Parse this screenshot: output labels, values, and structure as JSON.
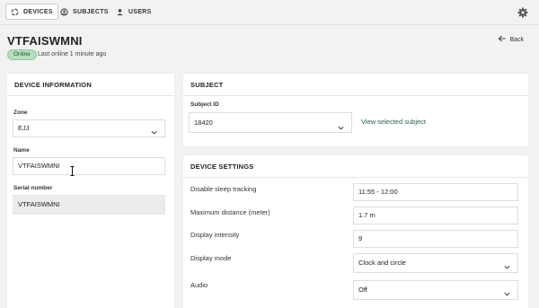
{
  "nav": {
    "tabs": [
      {
        "label": "DEVICES",
        "icon": "devices-icon"
      },
      {
        "label": "SUBJECTS",
        "icon": "subjects-icon"
      },
      {
        "label": "USERS",
        "icon": "user-icon"
      }
    ],
    "settings_icon": "gear-icon"
  },
  "header": {
    "title": "VTFAISWMNI",
    "back_label": "Back",
    "status_badge": "Online",
    "last_online": "Last online 1 minute ago"
  },
  "device_info": {
    "heading": "DEVICE INFORMATION",
    "zone_label": "Zone",
    "zone_value": "EJJ",
    "name_label": "Name",
    "name_value": "VTFAISWMNI",
    "serial_label": "Serial number",
    "serial_value": "VTFAISWMNI"
  },
  "subject": {
    "heading": "SUBJECT",
    "id_label": "Subject ID",
    "id_value": "18420",
    "view_link": "View selected subject"
  },
  "settings": {
    "heading": "DEVICE SETTINGS",
    "rows": [
      {
        "label": "Disable sleep tracking",
        "value": "11:55 - 12:00"
      },
      {
        "label": "Maximum distance (meter)",
        "value": "1.7 m"
      },
      {
        "label": "Display intensity",
        "value": "9"
      },
      {
        "label": "Display mode",
        "value": "Clock and circle"
      },
      {
        "label": "Audio",
        "value": "Off"
      }
    ]
  },
  "colors": {
    "background": "#f2f2f2",
    "online_badge": "#b6dfc0",
    "link": "#2f5d4d"
  }
}
